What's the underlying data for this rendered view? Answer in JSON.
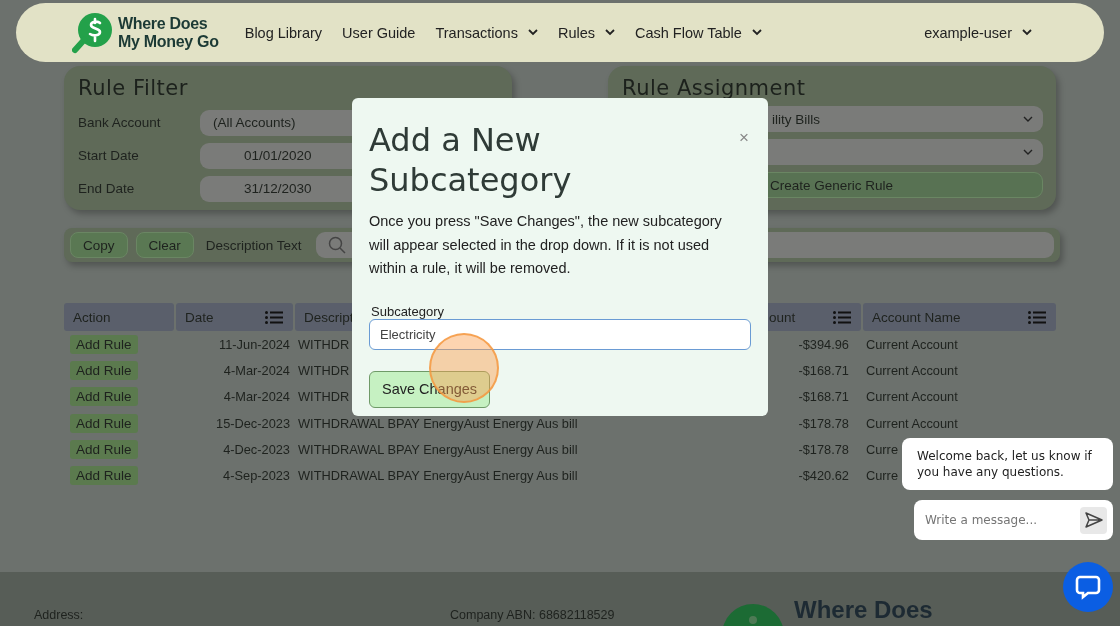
{
  "navbar": {
    "logo_lines": [
      "Where Does",
      "My Money Go"
    ],
    "links": [
      {
        "label": "Blog Library",
        "dropdown": false
      },
      {
        "label": "User Guide",
        "dropdown": false
      },
      {
        "label": "Transactions",
        "dropdown": true
      },
      {
        "label": "Rules",
        "dropdown": true
      },
      {
        "label": "Cash Flow Table",
        "dropdown": true
      }
    ],
    "user": {
      "label": "example-user",
      "dropdown": true
    }
  },
  "rule_filter": {
    "title": "Rule Filter",
    "fields": [
      {
        "label": "Bank Account",
        "value": "(All Accounts)",
        "kind": "select"
      },
      {
        "label": "Start Date",
        "value": "01/01/2020",
        "kind": "date"
      },
      {
        "label": "End Date",
        "value": "31/12/2030",
        "kind": "date"
      }
    ]
  },
  "rule_assignment": {
    "title": "Rule Assignment",
    "selects": [
      {
        "kind": "select",
        "value": "ility Bills"
      },
      {
        "kind": "select"
      }
    ],
    "button": "Create Generic Rule"
  },
  "toolbar": {
    "buttons": [
      "Copy",
      "Clear"
    ],
    "label": "Description Text"
  },
  "table": {
    "columns": [
      {
        "label": "Action",
        "filter_icon": false
      },
      {
        "label": "Date",
        "filter_icon": true
      },
      {
        "label": "Descript",
        "filter_icon": false
      },
      {
        "label": "ount",
        "filter_icon": true
      },
      {
        "label": "Account Name",
        "filter_icon": true
      }
    ],
    "rows": [
      {
        "action": "Add Rule",
        "date": "11-Jun-2024",
        "description": "WITHDR",
        "amount": "-$394.96",
        "account": "Current Account"
      },
      {
        "action": "Add Rule",
        "date": "4-Mar-2024",
        "description": "WITHDR",
        "amount": "-$168.71",
        "account": "Current Account"
      },
      {
        "action": "Add Rule",
        "date": "4-Mar-2024",
        "description": "WITHDR",
        "amount": "-$168.71",
        "account": "Current Account"
      },
      {
        "action": "Add Rule",
        "date": "15-Dec-2023",
        "description": "WITHDRAWAL BPAY EnergyAust Energy Aus bill",
        "amount": "-$178.78",
        "account": "Current Account"
      },
      {
        "action": "Add Rule",
        "date": "4-Dec-2023",
        "description": "WITHDRAWAL BPAY EnergyAust Energy Aus bill",
        "amount": "-$178.78",
        "account": "Curre"
      },
      {
        "action": "Add Rule",
        "date": "4-Sep-2023",
        "description": "WITHDRAWAL BPAY EnergyAust Energy Aus bill",
        "amount": "-$420.62",
        "account": "Curre"
      }
    ]
  },
  "modal": {
    "title": "Add a New Subcategory",
    "close": "×",
    "text": "Once you press \"Save Changes\", the new subcategory will appear selected in the drop down. If it is not used within a rule, it will be removed.",
    "field_label": "Subcategory",
    "field_value": "Electricity",
    "button": "Save Changes"
  },
  "chat": {
    "message": "Welcome back, let us know if you have any questions.",
    "placeholder": "Write a message..."
  },
  "footer": {
    "address": "Address:",
    "abn": "Company ABN: 68682118529",
    "logo_text": "Where Does"
  }
}
